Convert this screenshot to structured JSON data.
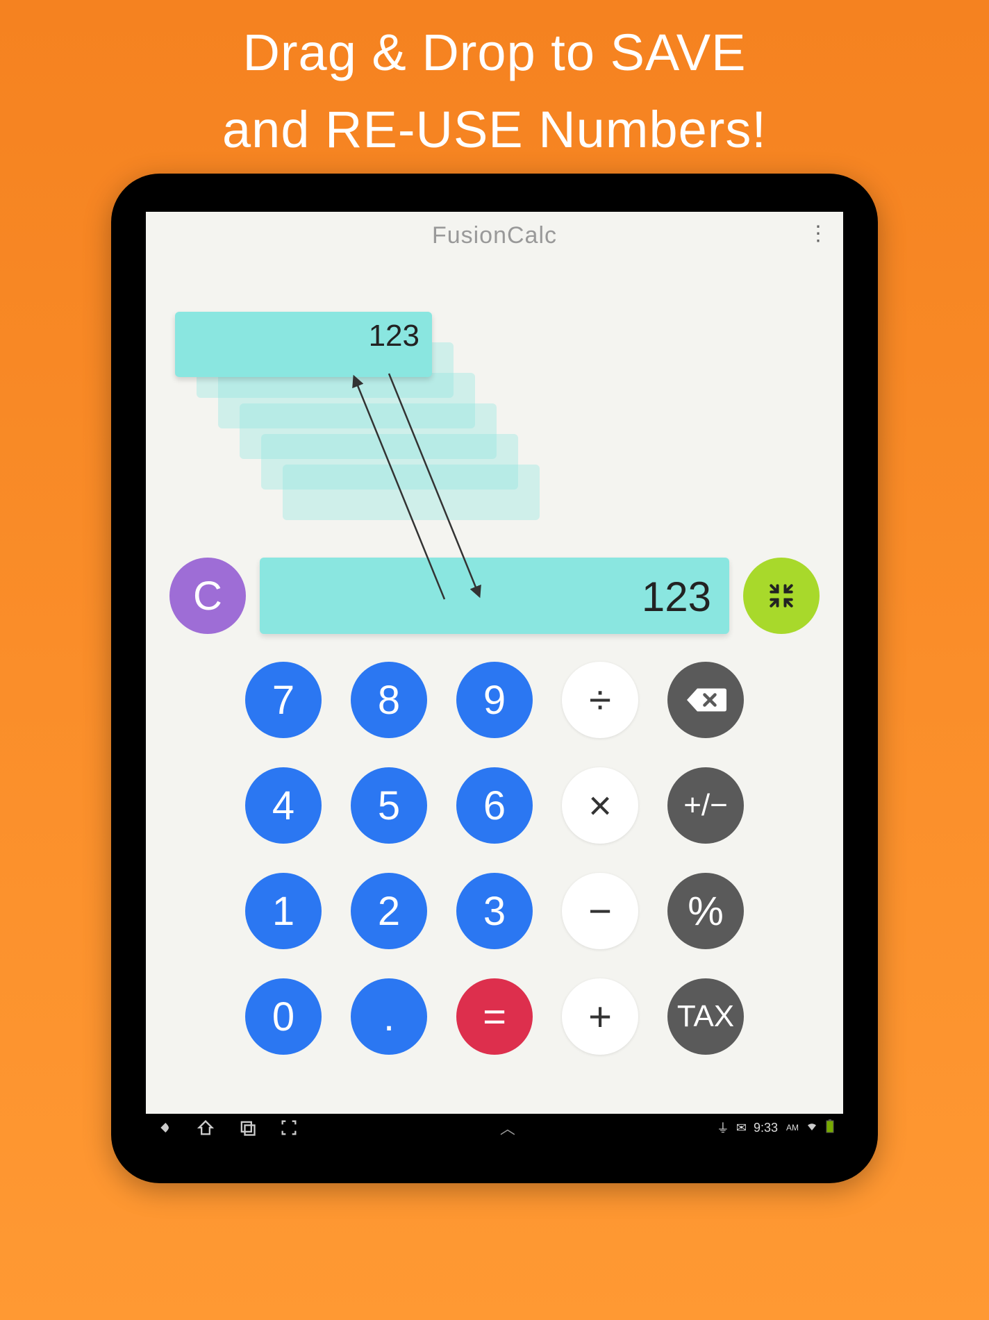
{
  "promo": {
    "line1": "Drag & Drop to SAVE",
    "line2": "and RE-USE Numbers!"
  },
  "app": {
    "title": "FusionCalc"
  },
  "chip": {
    "value": "123"
  },
  "display": {
    "value": "123"
  },
  "buttons": {
    "clear": "C",
    "seven": "7",
    "eight": "8",
    "nine": "9",
    "divide": "÷",
    "four": "4",
    "five": "5",
    "six": "6",
    "multiply": "×",
    "plusminus": "+/−",
    "one": "1",
    "two": "2",
    "three": "3",
    "minus": "−",
    "percent": "%",
    "zero": "0",
    "dot": ".",
    "equals": "=",
    "plus": "+",
    "tax": "TAX"
  },
  "statusbar": {
    "time": "9:33",
    "ampm": "AM"
  }
}
